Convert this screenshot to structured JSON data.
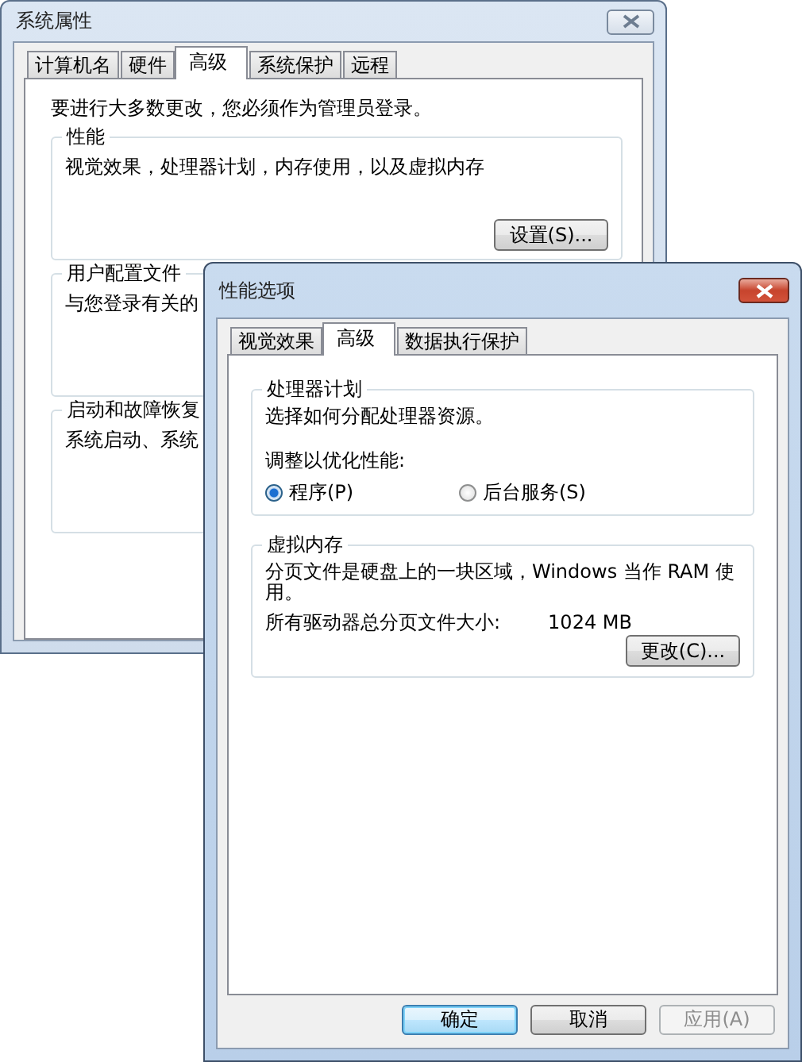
{
  "system_properties": {
    "title": "系统属性",
    "tabs": [
      {
        "label": "计算机名",
        "selected": false
      },
      {
        "label": "硬件",
        "selected": false
      },
      {
        "label": "高级",
        "selected": true
      },
      {
        "label": "系统保护",
        "selected": false
      },
      {
        "label": "远程",
        "selected": false
      }
    ],
    "notice": "要进行大多数更改，您必须作为管理员登录。",
    "groups": [
      {
        "title": "性能",
        "text": "视觉效果，处理器计划，内存使用，以及虚拟内存",
        "button": "设置(S)..."
      },
      {
        "title": "用户配置文件",
        "text": "与您登录有关的"
      },
      {
        "title": "启动和故障恢复",
        "text": "系统启动、系统"
      }
    ]
  },
  "performance_options": {
    "title": "性能选项",
    "tabs": [
      {
        "label": "视觉效果",
        "selected": false
      },
      {
        "label": "高级",
        "selected": true
      },
      {
        "label": "数据执行保护",
        "selected": false
      }
    ],
    "processor_scheduling": {
      "title": "处理器计划",
      "description": "选择如何分配处理器资源。",
      "adjust_label": "调整以优化性能:",
      "options": [
        {
          "label": "程序(P)",
          "selected": true
        },
        {
          "label": "后台服务(S)",
          "selected": false
        }
      ]
    },
    "virtual_memory": {
      "title": "虚拟内存",
      "description": "分页文件是硬盘上的一块区域，Windows 当作 RAM 使用。",
      "total_label": "所有驱动器总分页文件大小:",
      "total_value": "1024 MB",
      "button": "更改(C)..."
    },
    "buttons": [
      {
        "label": "确定",
        "kind": "default",
        "disabled": false
      },
      {
        "label": "取消",
        "kind": "normal",
        "disabled": false
      },
      {
        "label": "应用(A)",
        "kind": "normal",
        "disabled": true
      }
    ]
  }
}
